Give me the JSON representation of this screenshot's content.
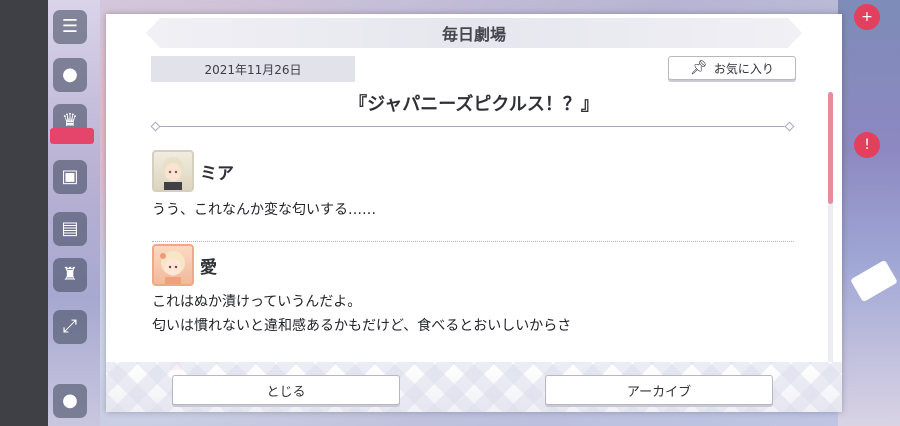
{
  "dialog": {
    "title": "毎日劇場",
    "date": "2021年11月26日",
    "favorite_label": "お気に入り",
    "story_title": "『ジャパニーズピクルス！？』"
  },
  "entries": [
    {
      "speaker": "ミア",
      "lines": [
        "うう、これなんか変な匂いする……"
      ]
    },
    {
      "speaker": "愛",
      "lines": [
        "これはぬか漬けっていうんだよ。",
        "匂いは慣れないと違和感あるかもだけど、食べるとおいしいからさ"
      ]
    }
  ],
  "footer": {
    "close_label": "とじる",
    "archive_label": "アーカイブ"
  },
  "colors": {
    "scroll_thumb": "#e88c9c",
    "accent_pink": "#e6456b"
  },
  "icons": {
    "favorite": "pin-icon",
    "side_menu": "menu-icon"
  }
}
